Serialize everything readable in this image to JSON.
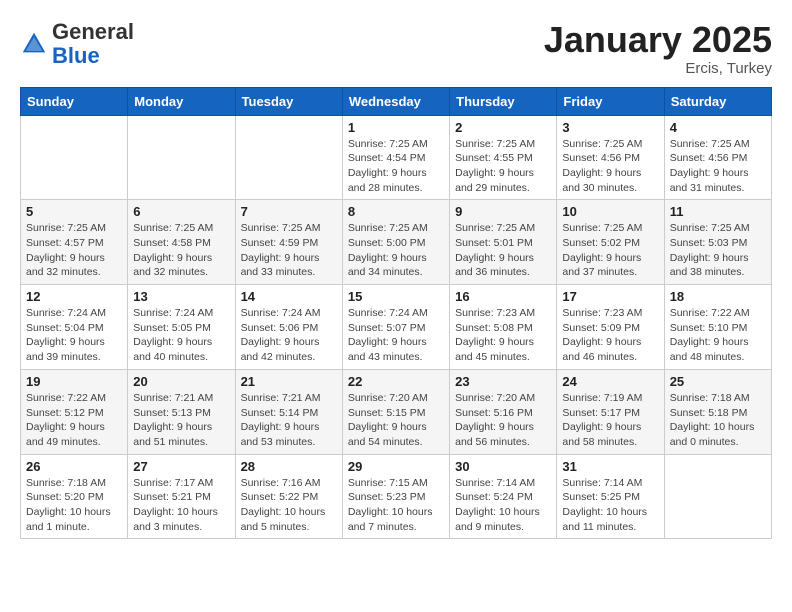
{
  "logo": {
    "general": "General",
    "blue": "Blue"
  },
  "header": {
    "month": "January 2025",
    "location": "Ercis, Turkey"
  },
  "weekdays": [
    "Sunday",
    "Monday",
    "Tuesday",
    "Wednesday",
    "Thursday",
    "Friday",
    "Saturday"
  ],
  "weeks": [
    [
      {
        "day": "",
        "info": ""
      },
      {
        "day": "",
        "info": ""
      },
      {
        "day": "",
        "info": ""
      },
      {
        "day": "1",
        "info": "Sunrise: 7:25 AM\nSunset: 4:54 PM\nDaylight: 9 hours\nand 28 minutes."
      },
      {
        "day": "2",
        "info": "Sunrise: 7:25 AM\nSunset: 4:55 PM\nDaylight: 9 hours\nand 29 minutes."
      },
      {
        "day": "3",
        "info": "Sunrise: 7:25 AM\nSunset: 4:56 PM\nDaylight: 9 hours\nand 30 minutes."
      },
      {
        "day": "4",
        "info": "Sunrise: 7:25 AM\nSunset: 4:56 PM\nDaylight: 9 hours\nand 31 minutes."
      }
    ],
    [
      {
        "day": "5",
        "info": "Sunrise: 7:25 AM\nSunset: 4:57 PM\nDaylight: 9 hours\nand 32 minutes."
      },
      {
        "day": "6",
        "info": "Sunrise: 7:25 AM\nSunset: 4:58 PM\nDaylight: 9 hours\nand 32 minutes."
      },
      {
        "day": "7",
        "info": "Sunrise: 7:25 AM\nSunset: 4:59 PM\nDaylight: 9 hours\nand 33 minutes."
      },
      {
        "day": "8",
        "info": "Sunrise: 7:25 AM\nSunset: 5:00 PM\nDaylight: 9 hours\nand 34 minutes."
      },
      {
        "day": "9",
        "info": "Sunrise: 7:25 AM\nSunset: 5:01 PM\nDaylight: 9 hours\nand 36 minutes."
      },
      {
        "day": "10",
        "info": "Sunrise: 7:25 AM\nSunset: 5:02 PM\nDaylight: 9 hours\nand 37 minutes."
      },
      {
        "day": "11",
        "info": "Sunrise: 7:25 AM\nSunset: 5:03 PM\nDaylight: 9 hours\nand 38 minutes."
      }
    ],
    [
      {
        "day": "12",
        "info": "Sunrise: 7:24 AM\nSunset: 5:04 PM\nDaylight: 9 hours\nand 39 minutes."
      },
      {
        "day": "13",
        "info": "Sunrise: 7:24 AM\nSunset: 5:05 PM\nDaylight: 9 hours\nand 40 minutes."
      },
      {
        "day": "14",
        "info": "Sunrise: 7:24 AM\nSunset: 5:06 PM\nDaylight: 9 hours\nand 42 minutes."
      },
      {
        "day": "15",
        "info": "Sunrise: 7:24 AM\nSunset: 5:07 PM\nDaylight: 9 hours\nand 43 minutes."
      },
      {
        "day": "16",
        "info": "Sunrise: 7:23 AM\nSunset: 5:08 PM\nDaylight: 9 hours\nand 45 minutes."
      },
      {
        "day": "17",
        "info": "Sunrise: 7:23 AM\nSunset: 5:09 PM\nDaylight: 9 hours\nand 46 minutes."
      },
      {
        "day": "18",
        "info": "Sunrise: 7:22 AM\nSunset: 5:10 PM\nDaylight: 9 hours\nand 48 minutes."
      }
    ],
    [
      {
        "day": "19",
        "info": "Sunrise: 7:22 AM\nSunset: 5:12 PM\nDaylight: 9 hours\nand 49 minutes."
      },
      {
        "day": "20",
        "info": "Sunrise: 7:21 AM\nSunset: 5:13 PM\nDaylight: 9 hours\nand 51 minutes."
      },
      {
        "day": "21",
        "info": "Sunrise: 7:21 AM\nSunset: 5:14 PM\nDaylight: 9 hours\nand 53 minutes."
      },
      {
        "day": "22",
        "info": "Sunrise: 7:20 AM\nSunset: 5:15 PM\nDaylight: 9 hours\nand 54 minutes."
      },
      {
        "day": "23",
        "info": "Sunrise: 7:20 AM\nSunset: 5:16 PM\nDaylight: 9 hours\nand 56 minutes."
      },
      {
        "day": "24",
        "info": "Sunrise: 7:19 AM\nSunset: 5:17 PM\nDaylight: 9 hours\nand 58 minutes."
      },
      {
        "day": "25",
        "info": "Sunrise: 7:18 AM\nSunset: 5:18 PM\nDaylight: 10 hours\nand 0 minutes."
      }
    ],
    [
      {
        "day": "26",
        "info": "Sunrise: 7:18 AM\nSunset: 5:20 PM\nDaylight: 10 hours\nand 1 minute."
      },
      {
        "day": "27",
        "info": "Sunrise: 7:17 AM\nSunset: 5:21 PM\nDaylight: 10 hours\nand 3 minutes."
      },
      {
        "day": "28",
        "info": "Sunrise: 7:16 AM\nSunset: 5:22 PM\nDaylight: 10 hours\nand 5 minutes."
      },
      {
        "day": "29",
        "info": "Sunrise: 7:15 AM\nSunset: 5:23 PM\nDaylight: 10 hours\nand 7 minutes."
      },
      {
        "day": "30",
        "info": "Sunrise: 7:14 AM\nSunset: 5:24 PM\nDaylight: 10 hours\nand 9 minutes."
      },
      {
        "day": "31",
        "info": "Sunrise: 7:14 AM\nSunset: 5:25 PM\nDaylight: 10 hours\nand 11 minutes."
      },
      {
        "day": "",
        "info": ""
      }
    ]
  ]
}
